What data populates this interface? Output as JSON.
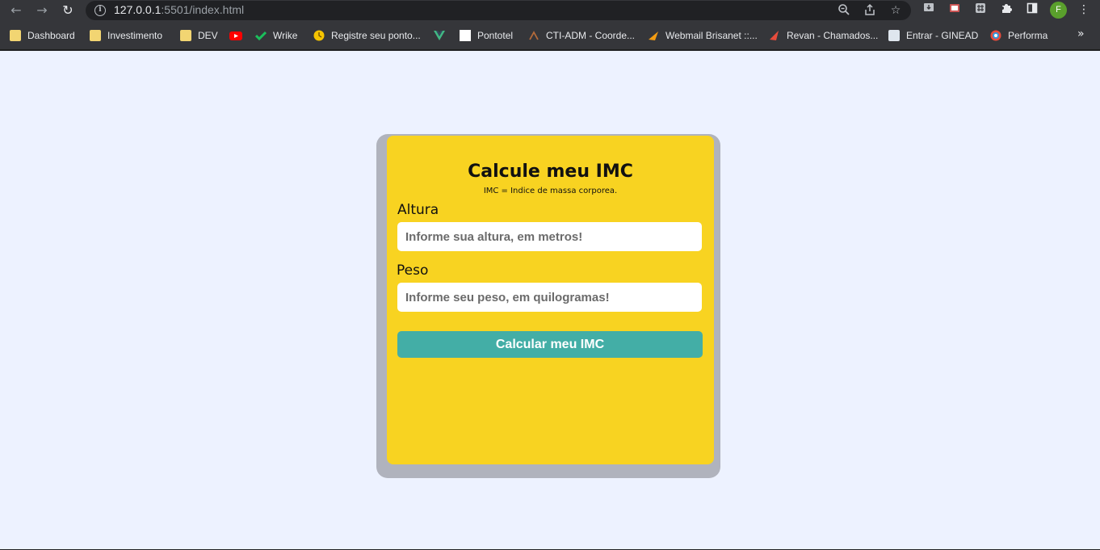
{
  "browser": {
    "url_host": "127.0.0.1",
    "url_rest": ":5501/index.html",
    "profile_initial": "F",
    "bookmarks": [
      {
        "label": "Dashboard",
        "icon": "folder-icon"
      },
      {
        "label": "Investimento",
        "icon": "folder-icon"
      },
      {
        "label": "DEV",
        "icon": "folder-icon"
      },
      {
        "label": "",
        "icon": "youtube-icon"
      },
      {
        "label": "Wrike",
        "icon": "wrike-icon"
      },
      {
        "label": "Registre seu ponto...",
        "icon": "clock-icon"
      },
      {
        "label": "",
        "icon": "vue-icon"
      },
      {
        "label": "Pontotel",
        "icon": "pontotel-icon"
      },
      {
        "label": "CTI-ADM - Coorde...",
        "icon": "cti-icon"
      },
      {
        "label": "Webmail Brisanet ::...",
        "icon": "webmail-icon"
      },
      {
        "label": "Revan - Chamados...",
        "icon": "revan-icon"
      },
      {
        "label": "Entrar - GINEAD",
        "icon": "ginead-icon"
      },
      {
        "label": "Performa",
        "icon": "performa-icon"
      }
    ],
    "more_glyph": "»"
  },
  "card": {
    "title": "Calcule meu IMC",
    "subtitle": "IMC = Indice de massa corporea.",
    "height_label": "Altura",
    "height_placeholder": "Informe sua altura, em metros!",
    "weight_label": "Peso",
    "weight_placeholder": "Informe seu peso, em quilogramas!",
    "button_label": "Calcular meu IMC"
  },
  "colors": {
    "page_bg": "#edf2ff",
    "card_bg": "#f8d321",
    "button_bg": "#43aea6"
  }
}
